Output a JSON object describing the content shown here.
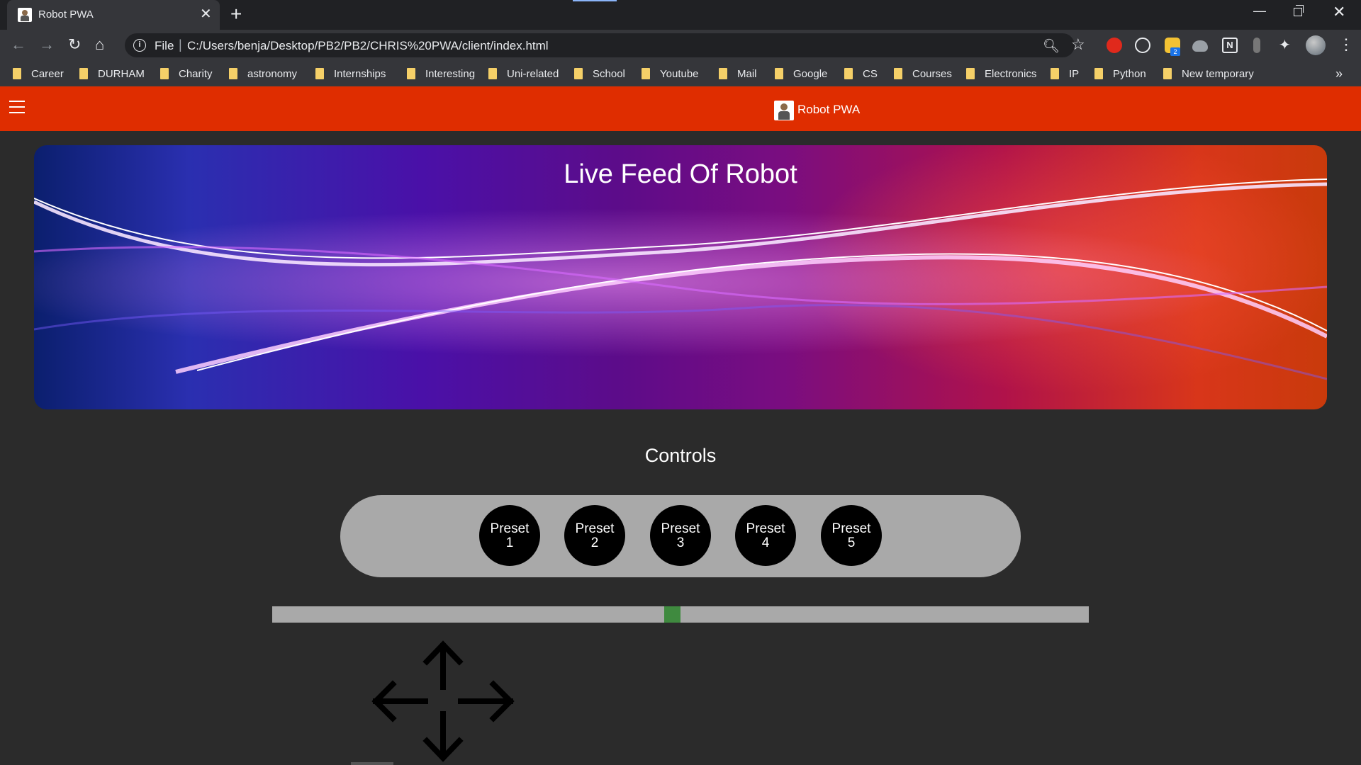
{
  "browser": {
    "tab": {
      "title": "Robot PWA"
    },
    "controls": {
      "tab_close": "✕",
      "new_tab": "+",
      "minimize": "—",
      "close": "✕",
      "back": "←",
      "forward": "→",
      "reload": "↻",
      "home": "⌂",
      "more": "»",
      "menu": "⋮"
    },
    "address": {
      "scheme": "File",
      "separator": "|",
      "url": "C:/Users/benja/Desktop/PB2/PB2/CHRIS%20PWA/client/index.html",
      "info": "i"
    },
    "icons": {
      "zoom": "zoom-icon",
      "star": "star-icon",
      "extensions": "puzzle-icon",
      "profile": "avatar"
    },
    "extensions": {
      "honey_badge": "2",
      "notion": "N"
    },
    "bookmarks": [
      "Career",
      "DURHAM",
      "Charity",
      "astronomy",
      "Internships",
      "Interesting",
      "Uni-related",
      "School",
      "Youtube",
      "Mail",
      "Google",
      "CS",
      "Courses",
      "Electronics",
      "IP",
      "Python",
      "New temporary"
    ]
  },
  "app": {
    "title": "Robot PWA",
    "header_color": "#df2d00",
    "feed": {
      "title": "Live Feed Of Robot"
    },
    "controls": {
      "heading": "Controls",
      "presets": [
        {
          "word": "Preset",
          "num": "1"
        },
        {
          "word": "Preset",
          "num": "2"
        },
        {
          "word": "Preset",
          "num": "3"
        },
        {
          "word": "Preset",
          "num": "4"
        },
        {
          "word": "Preset",
          "num": "5"
        }
      ],
      "slider": {
        "value_fraction": 0.49,
        "thumb_color": "#3f8a3f"
      },
      "dpad_icon": "move-arrows-icon"
    }
  }
}
